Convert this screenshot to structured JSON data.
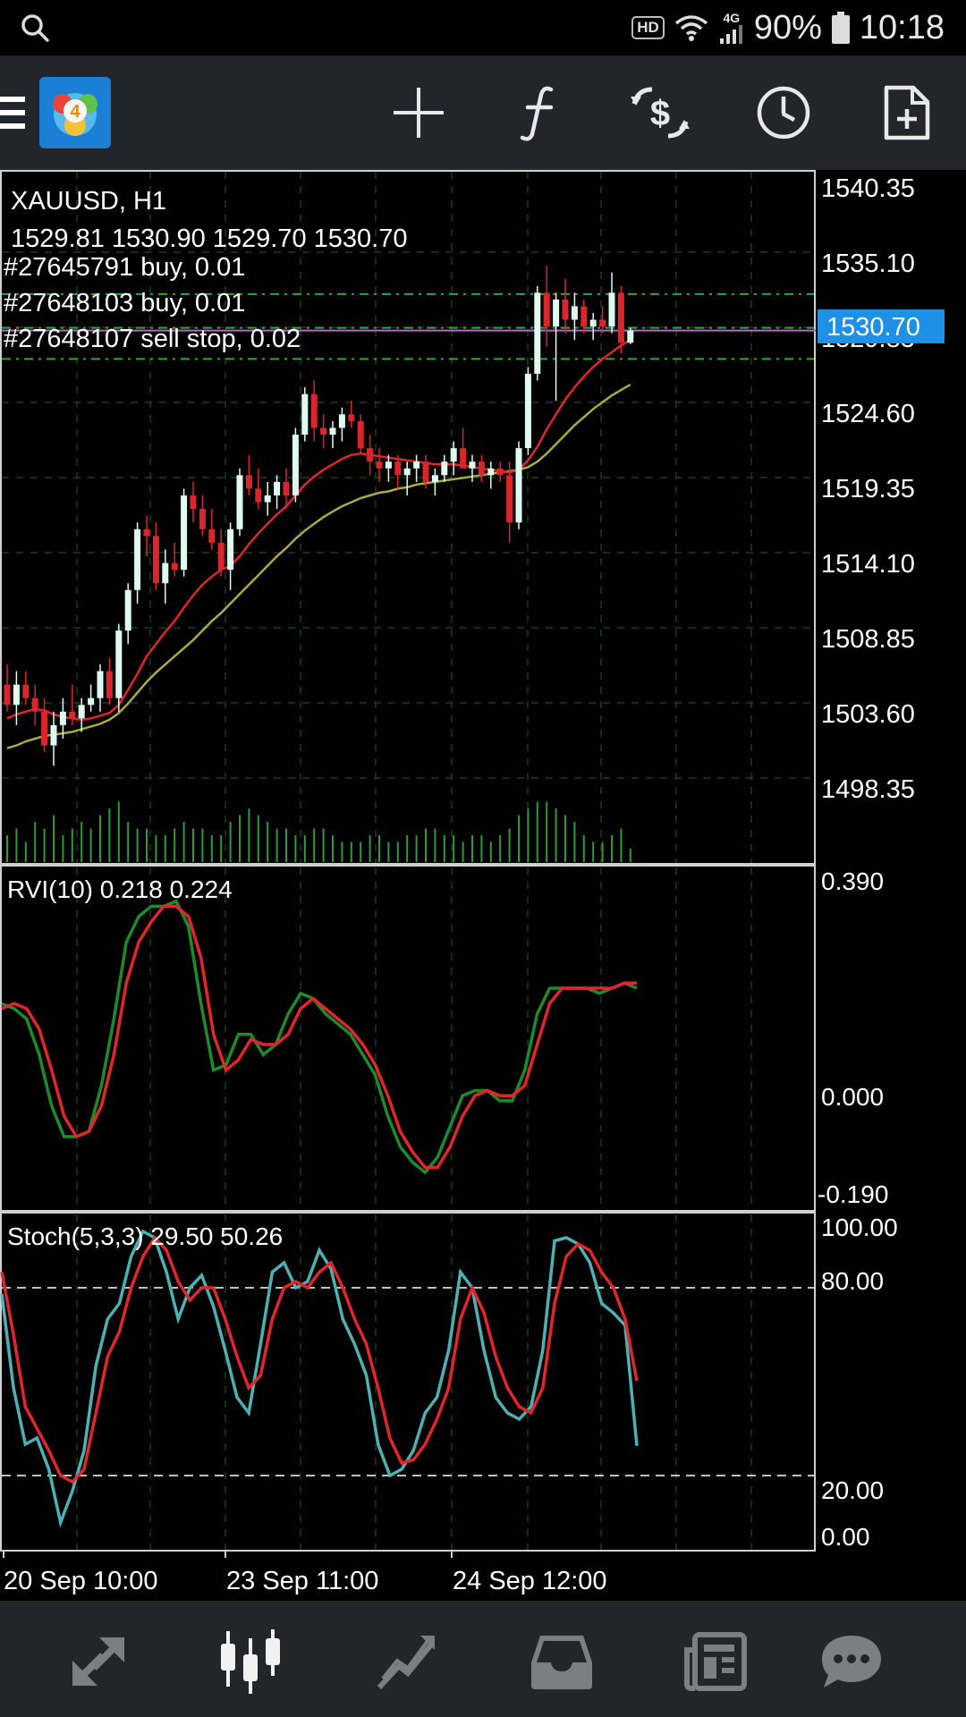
{
  "status_bar": {
    "hd_badge": "HD",
    "network": "4G",
    "battery": "90%",
    "time": "10:18"
  },
  "toolbar": {
    "icons": [
      "menu-icon",
      "app-logo-icon",
      "crosshair-icon",
      "indicator-f-icon",
      "trade-icon",
      "clock-icon",
      "new-document-icon"
    ]
  },
  "chart": {
    "symbol": "XAUUSD, H1",
    "ohlc": "1529.81 1530.90 1529.70 1530.70",
    "orders": [
      "#27645791 buy, 0.01",
      "#27648103 buy, 0.01",
      "#27648107 sell stop, 0.02"
    ],
    "current_price": "1530.70",
    "price_axis": [
      "1540.35",
      "1535.10",
      "1529.85",
      "1524.60",
      "1519.35",
      "1514.10",
      "1508.85",
      "1503.60",
      "1498.35"
    ],
    "rvi_label": "RVI(10) 0.218 0.224",
    "rvi_axis": [
      "0.390",
      "0.000",
      "-0.190"
    ],
    "stoch_label": "Stoch(5,3,3) 29.50 50.26",
    "stoch_axis": [
      "100.00",
      "80.00",
      "20.00",
      "0.00"
    ],
    "time_axis": [
      "20 Sep 10:00",
      "23 Sep 11:00",
      "24 Sep 12:00"
    ],
    "colors": {
      "bull_candle": "#dffbf0",
      "bear_candle": "#d9262b",
      "ma_fast": "#e1262b",
      "ma_slow": "#a9ab42",
      "rvi_main": "#1f8a2c",
      "rvi_signal": "#e1262b",
      "stoch_main": "#4fb0b3",
      "stoch_signal": "#e1262b",
      "volume": "#2f9a3b",
      "price_badge": "#1e90e6"
    }
  },
  "bottom_nav": {
    "items": [
      "quotes-icon",
      "chart-icon",
      "trade-icon",
      "history-icon",
      "news-icon",
      "chat-icon"
    ]
  },
  "chart_data": {
    "type": "candlestick",
    "title": "XAUUSD, H1",
    "ylim": [
      1496,
      1541
    ],
    "candles": [
      {
        "o": 1504.5,
        "h": 1506.0,
        "l": 1502.5,
        "c": 1503.0
      },
      {
        "o": 1503.0,
        "h": 1505.5,
        "l": 1501.5,
        "c": 1504.5
      },
      {
        "o": 1504.5,
        "h": 1505.5,
        "l": 1503.0,
        "c": 1503.5
      },
      {
        "o": 1503.5,
        "h": 1504.5,
        "l": 1501.5,
        "c": 1502.5
      },
      {
        "o": 1502.5,
        "h": 1503.5,
        "l": 1499.5,
        "c": 1500.0
      },
      {
        "o": 1500.0,
        "h": 1502.5,
        "l": 1498.5,
        "c": 1501.5
      },
      {
        "o": 1501.5,
        "h": 1503.5,
        "l": 1500.5,
        "c": 1502.5
      },
      {
        "o": 1502.5,
        "h": 1504.5,
        "l": 1501.5,
        "c": 1502.0
      },
      {
        "o": 1502.0,
        "h": 1503.5,
        "l": 1501.0,
        "c": 1503.0
      },
      {
        "o": 1503.0,
        "h": 1504.5,
        "l": 1502.5,
        "c": 1503.5
      },
      {
        "o": 1503.5,
        "h": 1506.0,
        "l": 1502.5,
        "c": 1505.5
      },
      {
        "o": 1505.5,
        "h": 1506.5,
        "l": 1503.0,
        "c": 1503.5
      },
      {
        "o": 1503.5,
        "h": 1509.0,
        "l": 1502.5,
        "c": 1508.5
      },
      {
        "o": 1508.5,
        "h": 1512.0,
        "l": 1507.5,
        "c": 1511.5
      },
      {
        "o": 1511.5,
        "h": 1516.5,
        "l": 1510.5,
        "c": 1516.0
      },
      {
        "o": 1516.0,
        "h": 1517.0,
        "l": 1514.0,
        "c": 1515.5
      },
      {
        "o": 1515.5,
        "h": 1516.5,
        "l": 1511.5,
        "c": 1512.0
      },
      {
        "o": 1512.0,
        "h": 1514.5,
        "l": 1510.5,
        "c": 1513.5
      },
      {
        "o": 1513.5,
        "h": 1515.0,
        "l": 1512.5,
        "c": 1513.0
      },
      {
        "o": 1513.0,
        "h": 1519.0,
        "l": 1512.5,
        "c": 1518.5
      },
      {
        "o": 1518.5,
        "h": 1519.5,
        "l": 1516.5,
        "c": 1517.5
      },
      {
        "o": 1517.5,
        "h": 1518.5,
        "l": 1515.5,
        "c": 1516.0
      },
      {
        "o": 1516.0,
        "h": 1517.5,
        "l": 1514.5,
        "c": 1515.0
      },
      {
        "o": 1515.0,
        "h": 1516.0,
        "l": 1512.5,
        "c": 1513.0
      },
      {
        "o": 1513.0,
        "h": 1516.5,
        "l": 1511.5,
        "c": 1516.0
      },
      {
        "o": 1516.0,
        "h": 1520.5,
        "l": 1515.5,
        "c": 1520.0
      },
      {
        "o": 1520.0,
        "h": 1521.5,
        "l": 1518.5,
        "c": 1519.0
      },
      {
        "o": 1519.0,
        "h": 1520.5,
        "l": 1517.5,
        "c": 1518.0
      },
      {
        "o": 1518.0,
        "h": 1519.5,
        "l": 1517.0,
        "c": 1518.5
      },
      {
        "o": 1518.5,
        "h": 1520.0,
        "l": 1517.5,
        "c": 1519.5
      },
      {
        "o": 1519.5,
        "h": 1520.5,
        "l": 1517.5,
        "c": 1518.5
      },
      {
        "o": 1518.5,
        "h": 1523.5,
        "l": 1518.0,
        "c": 1523.0
      },
      {
        "o": 1523.0,
        "h": 1526.5,
        "l": 1522.5,
        "c": 1526.0
      },
      {
        "o": 1526.0,
        "h": 1527.0,
        "l": 1522.5,
        "c": 1523.5
      },
      {
        "o": 1523.5,
        "h": 1524.5,
        "l": 1522.0,
        "c": 1523.0
      },
      {
        "o": 1523.0,
        "h": 1524.0,
        "l": 1522.0,
        "c": 1523.5
      },
      {
        "o": 1523.5,
        "h": 1525.0,
        "l": 1522.5,
        "c": 1524.5
      },
      {
        "o": 1524.5,
        "h": 1525.5,
        "l": 1523.5,
        "c": 1524.0
      },
      {
        "o": 1524.0,
        "h": 1524.5,
        "l": 1521.5,
        "c": 1522.0
      },
      {
        "o": 1522.0,
        "h": 1523.0,
        "l": 1520.0,
        "c": 1521.0
      },
      {
        "o": 1521.0,
        "h": 1522.0,
        "l": 1519.5,
        "c": 1520.5
      },
      {
        "o": 1520.5,
        "h": 1521.5,
        "l": 1519.5,
        "c": 1521.0
      },
      {
        "o": 1521.0,
        "h": 1521.5,
        "l": 1519.0,
        "c": 1520.0
      },
      {
        "o": 1520.0,
        "h": 1521.0,
        "l": 1518.5,
        "c": 1520.5
      },
      {
        "o": 1520.5,
        "h": 1521.5,
        "l": 1519.5,
        "c": 1521.0
      },
      {
        "o": 1521.0,
        "h": 1521.5,
        "l": 1519.0,
        "c": 1519.5
      },
      {
        "o": 1519.5,
        "h": 1520.5,
        "l": 1518.5,
        "c": 1520.0
      },
      {
        "o": 1520.0,
        "h": 1521.5,
        "l": 1519.5,
        "c": 1521.0
      },
      {
        "o": 1521.0,
        "h": 1522.5,
        "l": 1520.0,
        "c": 1522.0
      },
      {
        "o": 1522.0,
        "h": 1523.5,
        "l": 1521.0,
        "c": 1520.5
      },
      {
        "o": 1520.5,
        "h": 1521.5,
        "l": 1519.5,
        "c": 1521.0
      },
      {
        "o": 1521.0,
        "h": 1521.5,
        "l": 1519.5,
        "c": 1520.0
      },
      {
        "o": 1520.0,
        "h": 1521.0,
        "l": 1519.0,
        "c": 1520.5
      },
      {
        "o": 1520.5,
        "h": 1521.0,
        "l": 1519.5,
        "c": 1520.0
      },
      {
        "o": 1520.0,
        "h": 1521.0,
        "l": 1515.0,
        "c": 1516.5
      },
      {
        "o": 1516.5,
        "h": 1522.5,
        "l": 1516.0,
        "c": 1522.0
      },
      {
        "o": 1522.0,
        "h": 1528.0,
        "l": 1521.5,
        "c": 1527.5
      },
      {
        "o": 1527.5,
        "h": 1534.0,
        "l": 1527.0,
        "c": 1533.5
      },
      {
        "o": 1533.5,
        "h": 1535.5,
        "l": 1529.5,
        "c": 1531.0
      },
      {
        "o": 1531.0,
        "h": 1533.5,
        "l": 1525.5,
        "c": 1533.0
      },
      {
        "o": 1533.0,
        "h": 1534.5,
        "l": 1530.5,
        "c": 1531.5
      },
      {
        "o": 1531.5,
        "h": 1533.5,
        "l": 1530.0,
        "c": 1532.5
      },
      {
        "o": 1532.5,
        "h": 1533.0,
        "l": 1530.5,
        "c": 1531.0
      },
      {
        "o": 1531.0,
        "h": 1532.0,
        "l": 1530.0,
        "c": 1531.5
      },
      {
        "o": 1531.5,
        "h": 1532.5,
        "l": 1530.5,
        "c": 1531.0
      },
      {
        "o": 1531.0,
        "h": 1535.0,
        "l": 1530.5,
        "c": 1533.5
      },
      {
        "o": 1533.5,
        "h": 1534.0,
        "l": 1529.0,
        "c": 1529.8
      },
      {
        "o": 1529.8,
        "h": 1530.9,
        "l": 1529.7,
        "c": 1530.7
      }
    ],
    "ma_fast": [
      1502.0,
      1502.3,
      1502.5,
      1502.7,
      1502.6,
      1502.3,
      1502.1,
      1502.0,
      1501.9,
      1502.0,
      1502.2,
      1502.4,
      1503.0,
      1504.1,
      1505.3,
      1506.6,
      1507.5,
      1508.4,
      1509.2,
      1510.2,
      1511.1,
      1511.9,
      1512.5,
      1513.0,
      1513.3,
      1514.0,
      1514.9,
      1515.7,
      1516.4,
      1517.1,
      1517.7,
      1518.5,
      1519.3,
      1519.9,
      1520.4,
      1520.8,
      1521.2,
      1521.5,
      1521.6,
      1521.5,
      1521.4,
      1521.3,
      1521.2,
      1521.1,
      1521.0,
      1520.9,
      1520.8,
      1520.8,
      1520.8,
      1520.7,
      1520.6,
      1520.5,
      1520.4,
      1520.3,
      1520.2,
      1520.4,
      1521.1,
      1522.1,
      1523.4,
      1524.5,
      1525.6,
      1526.5,
      1527.3,
      1528.0,
      1528.6,
      1529.1,
      1529.6,
      1530.0
    ],
    "ma_slow": [
      1499.8,
      1500.0,
      1500.3,
      1500.5,
      1500.7,
      1500.8,
      1500.9,
      1501.0,
      1501.2,
      1501.4,
      1501.6,
      1501.9,
      1502.4,
      1503.1,
      1503.9,
      1504.7,
      1505.4,
      1506.0,
      1506.6,
      1507.2,
      1507.8,
      1508.5,
      1509.2,
      1509.8,
      1510.5,
      1511.2,
      1511.9,
      1512.6,
      1513.3,
      1514.0,
      1514.6,
      1515.3,
      1515.9,
      1516.4,
      1516.9,
      1517.3,
      1517.7,
      1518.0,
      1518.3,
      1518.5,
      1518.7,
      1518.8,
      1519.0,
      1519.1,
      1519.3,
      1519.4,
      1519.5,
      1519.6,
      1519.7,
      1519.8,
      1519.9,
      1520.0,
      1520.1,
      1520.2,
      1520.3,
      1520.4,
      1520.6,
      1521.0,
      1521.6,
      1522.3,
      1523.0,
      1523.7,
      1524.3,
      1524.9,
      1525.4,
      1525.9,
      1526.3,
      1526.7
    ],
    "order_levels": [
      1533.4,
      1530.9,
      1528.6
    ],
    "volume": [
      4,
      5,
      3,
      6,
      5,
      7,
      4,
      5,
      6,
      5,
      7,
      8,
      9,
      6,
      5,
      5,
      4,
      4,
      5,
      6,
      5,
      5,
      4,
      4,
      6,
      7,
      8,
      7,
      6,
      5,
      5,
      4,
      4,
      5,
      5,
      4,
      3,
      3,
      3,
      4,
      4,
      3,
      3,
      4,
      4,
      5,
      5,
      4,
      4,
      3,
      4,
      4,
      3,
      4,
      5,
      7,
      8,
      9,
      9,
      8,
      7,
      6,
      4,
      3,
      3,
      4,
      5,
      2
    ],
    "volume_max": 10,
    "rvi": {
      "ylim": [
        -0.19,
        0.39
      ],
      "main": [
        0.18,
        0.17,
        0.15,
        0.08,
        -0.02,
        -0.08,
        -0.08,
        -0.07,
        0.02,
        0.15,
        0.3,
        0.35,
        0.37,
        0.37,
        0.38,
        0.33,
        0.18,
        0.05,
        0.06,
        0.12,
        0.12,
        0.08,
        0.1,
        0.16,
        0.2,
        0.19,
        0.16,
        0.14,
        0.12,
        0.08,
        0.04,
        -0.04,
        -0.1,
        -0.13,
        -0.15,
        -0.12,
        -0.06,
        0.0,
        0.01,
        0.01,
        -0.01,
        -0.01,
        0.05,
        0.16,
        0.21,
        0.21,
        0.21,
        0.21,
        0.2,
        0.21,
        0.22,
        0.21
      ],
      "signal": [
        0.17,
        0.18,
        0.17,
        0.13,
        0.05,
        -0.04,
        -0.08,
        -0.07,
        -0.02,
        0.08,
        0.22,
        0.3,
        0.34,
        0.37,
        0.37,
        0.35,
        0.27,
        0.12,
        0.05,
        0.07,
        0.11,
        0.1,
        0.1,
        0.12,
        0.17,
        0.19,
        0.17,
        0.15,
        0.13,
        0.1,
        0.06,
        0.0,
        -0.07,
        -0.11,
        -0.14,
        -0.14,
        -0.1,
        -0.04,
        0.0,
        0.01,
        0.0,
        0.0,
        0.02,
        0.1,
        0.18,
        0.21,
        0.21,
        0.21,
        0.21,
        0.21,
        0.22,
        0.22
      ]
    },
    "stoch": {
      "ylim": [
        0,
        100
      ],
      "main": [
        78,
        48,
        30,
        32,
        22,
        5,
        15,
        28,
        55,
        70,
        75,
        90,
        98,
        96,
        85,
        70,
        80,
        84,
        74,
        60,
        45,
        40,
        62,
        85,
        88,
        80,
        82,
        92,
        86,
        70,
        62,
        52,
        30,
        20,
        22,
        28,
        40,
        45,
        60,
        85,
        80,
        60,
        45,
        40,
        38,
        42,
        60,
        95,
        96,
        94,
        88,
        75,
        72,
        68,
        29.5
      ],
      "signal": [
        85,
        65,
        42,
        35,
        28,
        20,
        18,
        22,
        40,
        58,
        66,
        80,
        90,
        96,
        92,
        82,
        76,
        80,
        80,
        70,
        58,
        48,
        52,
        70,
        80,
        82,
        80,
        85,
        88,
        80,
        70,
        62,
        48,
        32,
        24,
        25,
        30,
        38,
        48,
        70,
        80,
        72,
        58,
        48,
        42,
        40,
        48,
        75,
        90,
        94,
        92,
        85,
        80,
        70,
        50.26
      ]
    },
    "xlabel_ticks": [
      "20 Sep 10:00",
      "23 Sep 11:00",
      "24 Sep 12:00"
    ]
  }
}
